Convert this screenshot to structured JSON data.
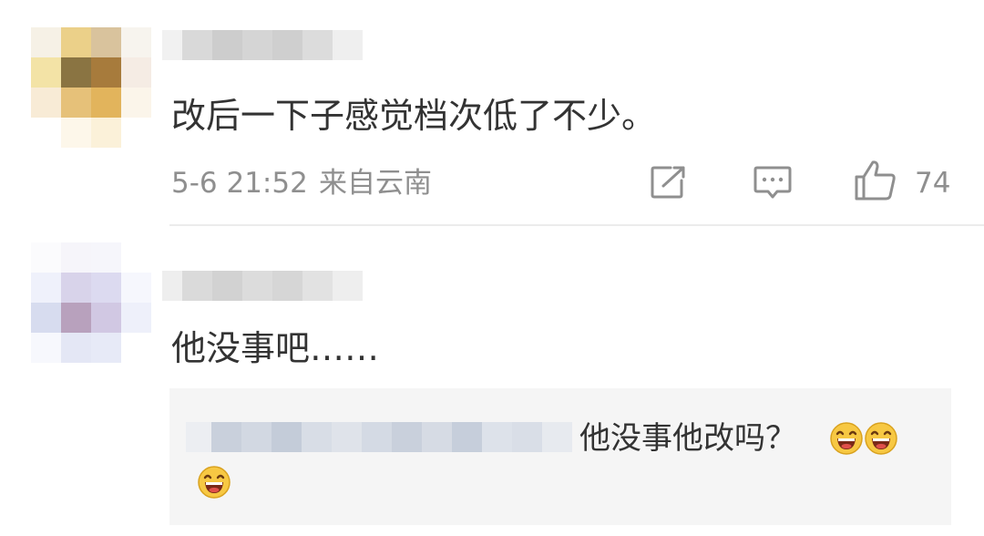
{
  "comments": [
    {
      "avatar_icon": "pixelated-avatar-icon",
      "text": "改后一下子感觉档次低了不少。",
      "date": "5-6 21:52",
      "location": "来自云南",
      "like_count": "74",
      "share_icon": "share-icon",
      "reply_icon": "comment-icon",
      "like_icon": "thumbs-up-icon"
    },
    {
      "avatar_icon": "pixelated-avatar-icon",
      "text": "他没事吧……",
      "reply": {
        "text": "他没事他改吗？",
        "emoji": [
          "laughing-emoji-icon",
          "laughing-emoji-icon",
          "laughing-emoji-icon"
        ]
      }
    }
  ],
  "colors": {
    "text": "#333333",
    "meta": "#8f8f8f",
    "reply_background": "#f5f5f5",
    "divider": "#ececec"
  }
}
